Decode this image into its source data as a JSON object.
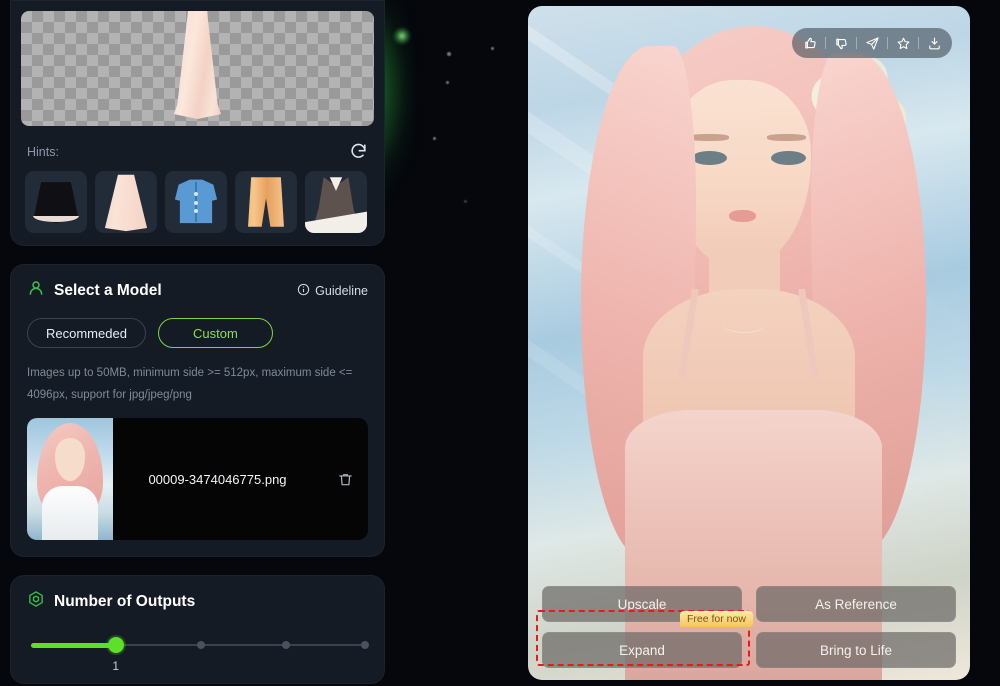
{
  "background": {
    "accent_green": "#5ee028",
    "page_bg": "#05070c"
  },
  "preview": {
    "name": "garment-preview",
    "hints_label": "Hints:",
    "refresh_icon": "refresh-icon",
    "hint_items": [
      {
        "name": "black-skirt",
        "art": "art-skirt-black"
      },
      {
        "name": "pink-long-skirt",
        "art": "art-skirt-pink"
      },
      {
        "name": "blue-cardigan",
        "art": "art-cardigan"
      },
      {
        "name": "orange-pants",
        "art": "art-pants"
      },
      {
        "name": "dark-dress",
        "art": "art-dress"
      }
    ]
  },
  "model_card": {
    "icon": "person-icon",
    "title": "Select a Model",
    "guideline_label": "Guideline",
    "guideline_icon": "info-circle-icon",
    "toggle": {
      "options": [
        "Recommeded",
        "Custom"
      ],
      "selected": "Custom"
    },
    "note": "Images up to 50MB, minimum side >= 512px, maximum side <= 4096px, support for jpg/jpeg/png",
    "upload": {
      "file_name": "00009-3474046775.png",
      "delete_icon": "trash-icon",
      "thumbnail": "uploaded-model-thumbnail"
    }
  },
  "outputs_card": {
    "icon": "hexagon-icon",
    "title": "Number of Outputs",
    "value": "1",
    "handle_percent": 26,
    "tick_percents": [
      26,
      51,
      76,
      100
    ]
  },
  "image_panel": {
    "toolbar": [
      {
        "name": "thumbs-up-icon",
        "glyph": "like"
      },
      {
        "name": "thumbs-down-icon",
        "glyph": "dislike"
      },
      {
        "name": "send-icon",
        "glyph": "send"
      },
      {
        "name": "star-icon",
        "glyph": "star"
      },
      {
        "name": "download-icon",
        "glyph": "download"
      }
    ],
    "actions": [
      {
        "name": "upscale-button",
        "label": "Upscale"
      },
      {
        "name": "as-reference-button",
        "label": "As Reference"
      },
      {
        "name": "expand-button",
        "label": "Expand"
      },
      {
        "name": "bring-to-life-button",
        "label": "Bring to Life"
      }
    ],
    "badge": {
      "label": "Free for now",
      "color": "#f6c55a"
    },
    "highlight_color": "#e81b1b"
  }
}
